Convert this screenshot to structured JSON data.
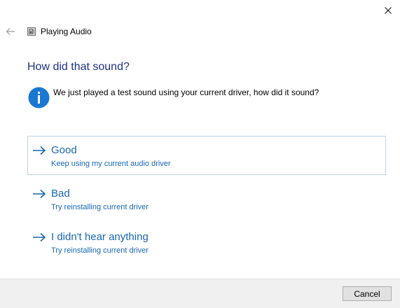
{
  "window": {
    "title": "Playing Audio",
    "close_icon": "close-icon",
    "back_icon": "back-arrow-icon",
    "title_icon": "audio-device-icon"
  },
  "main": {
    "heading": "How did that sound?",
    "info_icon": "info-icon",
    "info_text": "We just played a test sound using your current driver, how did it sound?",
    "options": [
      {
        "title": "Good",
        "description": "Keep using my current audio driver",
        "icon": "arrow-right-icon",
        "focused": true
      },
      {
        "title": "Bad",
        "description": "Try reinstalling current driver",
        "icon": "arrow-right-icon",
        "focused": false
      },
      {
        "title": "I didn't hear anything",
        "description": "Try reinstalling current driver",
        "icon": "arrow-right-icon",
        "focused": false
      }
    ]
  },
  "footer": {
    "cancel_label": "Cancel"
  },
  "colors": {
    "heading": "#1e3287",
    "link": "#1767b3",
    "info_icon_bg": "#1a78d2",
    "focus_border": "#b8d4ea",
    "footer_bg": "#f0f0f0"
  }
}
